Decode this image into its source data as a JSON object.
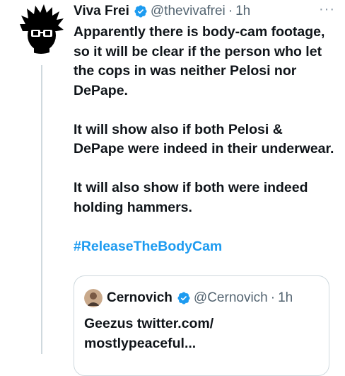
{
  "tweet": {
    "display_name": "Viva Frei",
    "handle": "@thevivafrei",
    "time": "1h",
    "more_label": "···",
    "paragraphs": [
      "Apparently there is body-cam footage, so it will be clear if the person who let the cops in was neither Pelosi nor DePape.",
      "It will show also if both Pelosi & DePape were indeed in their underwear.",
      "It will also show if both were indeed holding hammers."
    ],
    "hashtag": "#ReleaseTheBodyCam"
  },
  "quote": {
    "display_name": "Cernovich",
    "handle": "@Cernovich",
    "time": "1h",
    "text_line1": "Geezus twitter.com/",
    "text_line2": "mostlypeaceful..."
  },
  "colors": {
    "link": "#1d9bf0",
    "verified": "#1d9bf0",
    "secondary_text": "#536471",
    "border": "#cfd9de"
  },
  "icons": {
    "avatar": "spiky-hair-glasses-avatar",
    "verified": "verified-badge-icon",
    "more": "more-options-icon"
  }
}
